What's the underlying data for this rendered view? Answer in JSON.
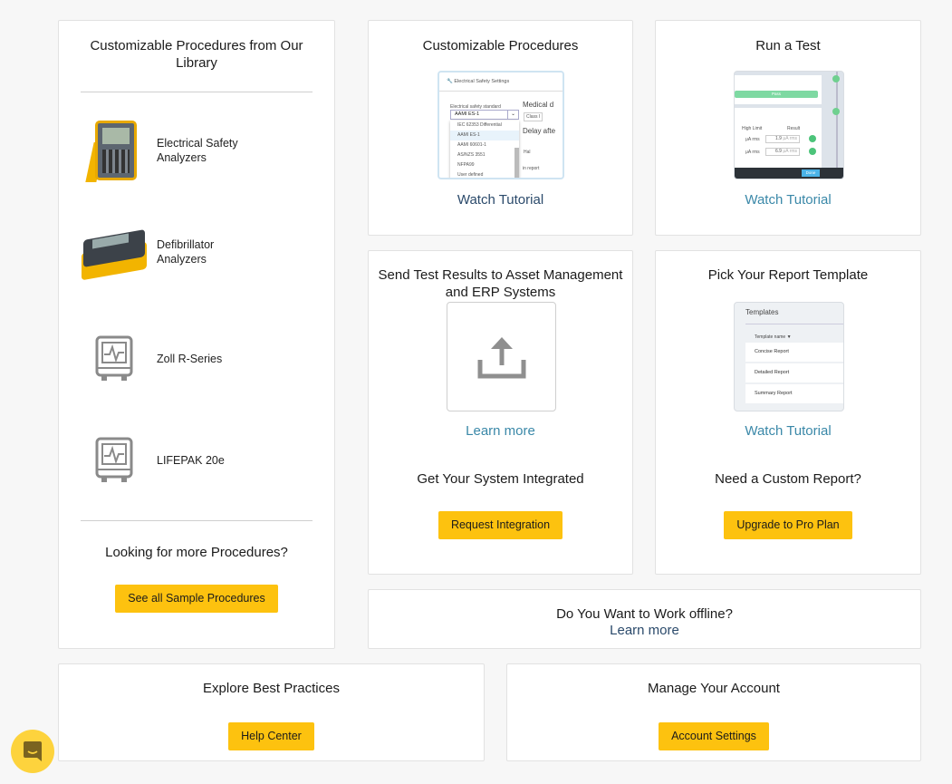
{
  "library": {
    "title": "Customizable Procedures from Our Library",
    "items": [
      {
        "label": "Electrical Safety Analyzers",
        "icon": "electrical-safety-analyzer-image"
      },
      {
        "label": "Defibrillator Analyzers",
        "icon": "defibrillator-analyzer-image"
      },
      {
        "label": "Zoll R-Series",
        "icon": "monitor-device-icon"
      },
      {
        "label": "LIFEPAK 20e",
        "icon": "monitor-device-icon"
      }
    ],
    "more_title": "Looking for more Procedures?",
    "more_button": "See all Sample Procedures"
  },
  "custom_procedures": {
    "title": "Customizable Procedures",
    "link": "Watch Tutorial",
    "thumb": {
      "header": "Electrical Safety Settings",
      "field_label": "Electrical safety standard",
      "selected": "AAMI ES-1",
      "side_label": "Medical d",
      "side_value": "Class I",
      "delay_label": "Delay afte",
      "hat_label": "Hal",
      "report_label": "in report",
      "options": [
        "IEC 62353 Differential",
        "AAMI ES-1",
        "AAMI 60601-1",
        "AS/NZS 3551",
        "NFPA99",
        "User defined"
      ]
    }
  },
  "run_test": {
    "title": "Run a Test",
    "link": "Watch Tutorial",
    "thumb": {
      "pass": "Pass",
      "col1": "High Limit",
      "col2": "Result",
      "rows": [
        {
          "unit": "μA rms",
          "value": "1.9",
          "placeholder": "μA rms"
        },
        {
          "unit": "μA rms",
          "value": "6.9",
          "placeholder": "μA rms"
        }
      ],
      "done": "Done"
    }
  },
  "send_results": {
    "title": "Send Test Results to Asset Management and ERP Systems",
    "link": "Learn more",
    "sub_title": "Get Your System Integrated",
    "button": "Request Integration"
  },
  "report_template": {
    "title": "Pick Your Report Template",
    "link": "Watch Tutorial",
    "thumb": {
      "header": "Templates",
      "column": "Template name",
      "rows": [
        "Concise Report",
        "Detailed Report",
        "Summary Report"
      ]
    },
    "sub_title": "Need a Custom Report?",
    "button": "Upgrade to Pro Plan"
  },
  "offline": {
    "title": "Do You Want to Work offline?",
    "link": "Learn more"
  },
  "best_practices": {
    "title": "Explore Best Practices",
    "button": "Help Center"
  },
  "account": {
    "title": "Manage Your Account",
    "button": "Account Settings"
  },
  "colors": {
    "button": "#fdc20f",
    "link": "#3a88a8",
    "link_dark": "#2b4a6b",
    "chat": "#fdd33d"
  }
}
